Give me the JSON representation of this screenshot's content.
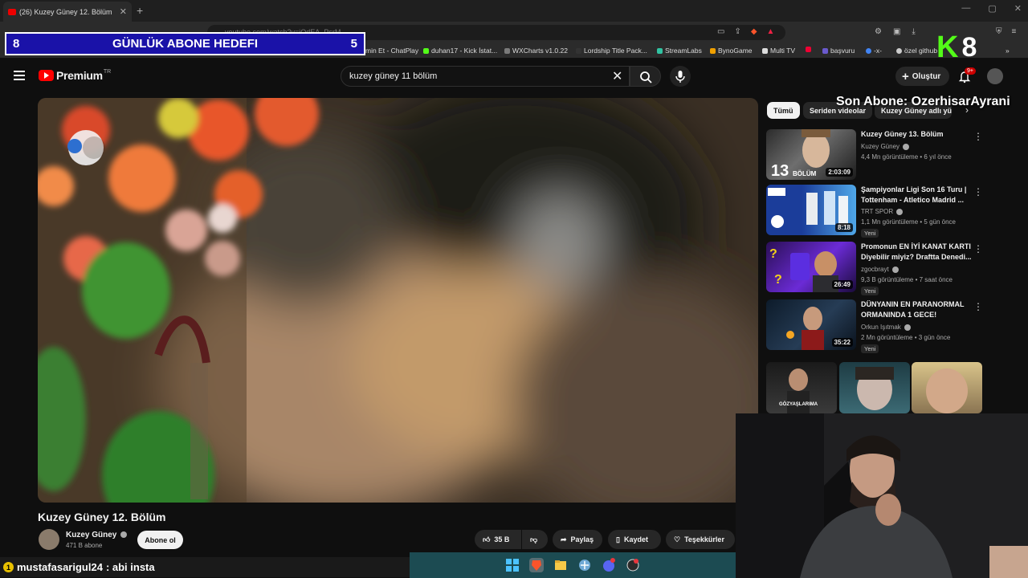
{
  "browser": {
    "tab_title": "(26) Kuzey Güney 12. Bölüm",
    "url": "youtube.com/watch?v=iQdEA_PsrM",
    "bookmarks": [
      "min Et - ChatPlay",
      "duhan17 - Kick İstat...",
      "WXCharts v1.0.22",
      "Lordship Title Pack...",
      "StreamLabs",
      "BynoGame",
      "Multi TV",
      "başvuru",
      "-x-",
      "özel github"
    ]
  },
  "overlay": {
    "goal_left": "8",
    "goal_title": "GÜNLÜK ABONE HEDEFI",
    "goal_right": "5",
    "kick_count": "8",
    "last_sub": "Son Abone: OzerhisarAyrani"
  },
  "youtube": {
    "logo_text": "Premium",
    "logo_region": "TR",
    "search_value": "kuzey güney 11 bölüm",
    "create_label": "Oluştur",
    "notif_count": "9+",
    "video_title": "Kuzey Güney 12. Bölüm",
    "channel_name": "Kuzey Güney",
    "channel_subs": "471 B abone",
    "subscribe_label": "Abone ol",
    "like_count": "35 B",
    "share_label": "Paylaş",
    "save_label": "Kaydet",
    "thanks_label": "Teşekkürler",
    "chips": [
      "Tümü",
      "Seriden videolar",
      "Kuzey Güney adlı yük"
    ],
    "recommendations": [
      {
        "title": "Kuzey Güney 13. Bölüm",
        "channel": "Kuzey Güney",
        "meta": "4,4 Mn görüntüleme • 6 yıl önce",
        "duration": "2:03:09",
        "new": ""
      },
      {
        "title": "Şampiyonlar Ligi Son 16 Turu | Tottenham - Atletico Madrid ...",
        "channel": "TRT SPOR",
        "meta": "1,1 Mn görüntüleme • 5 gün önce",
        "duration": "8:18",
        "new": "Yeni"
      },
      {
        "title": "Promonun EN İYİ KANAT KARTI Diyebilir miyiz? Draftta Denedi...",
        "channel": "zgocbrayt",
        "meta": "9,3 B görüntüleme • 7 saat önce",
        "duration": "26:49",
        "new": "Yeni"
      },
      {
        "title": "DÜNYANIN EN PARANORMAL ORMANINDA 1 GECE!",
        "channel": "Orkun Işıtmak",
        "meta": "2 Mn görüntüleme • 3 gün önce",
        "duration": "35:22",
        "new": "Yeni"
      }
    ],
    "short_label": "GÖZYAŞLARIMA"
  },
  "chat": {
    "badge": "1",
    "user": "mustafasarigul24",
    "message": ": abi insta"
  },
  "colors": {
    "goal_bg": "#1a12a8",
    "kick_green": "#53fc18",
    "yt_red": "#ff0000",
    "taskbar": "#1c4b52"
  }
}
